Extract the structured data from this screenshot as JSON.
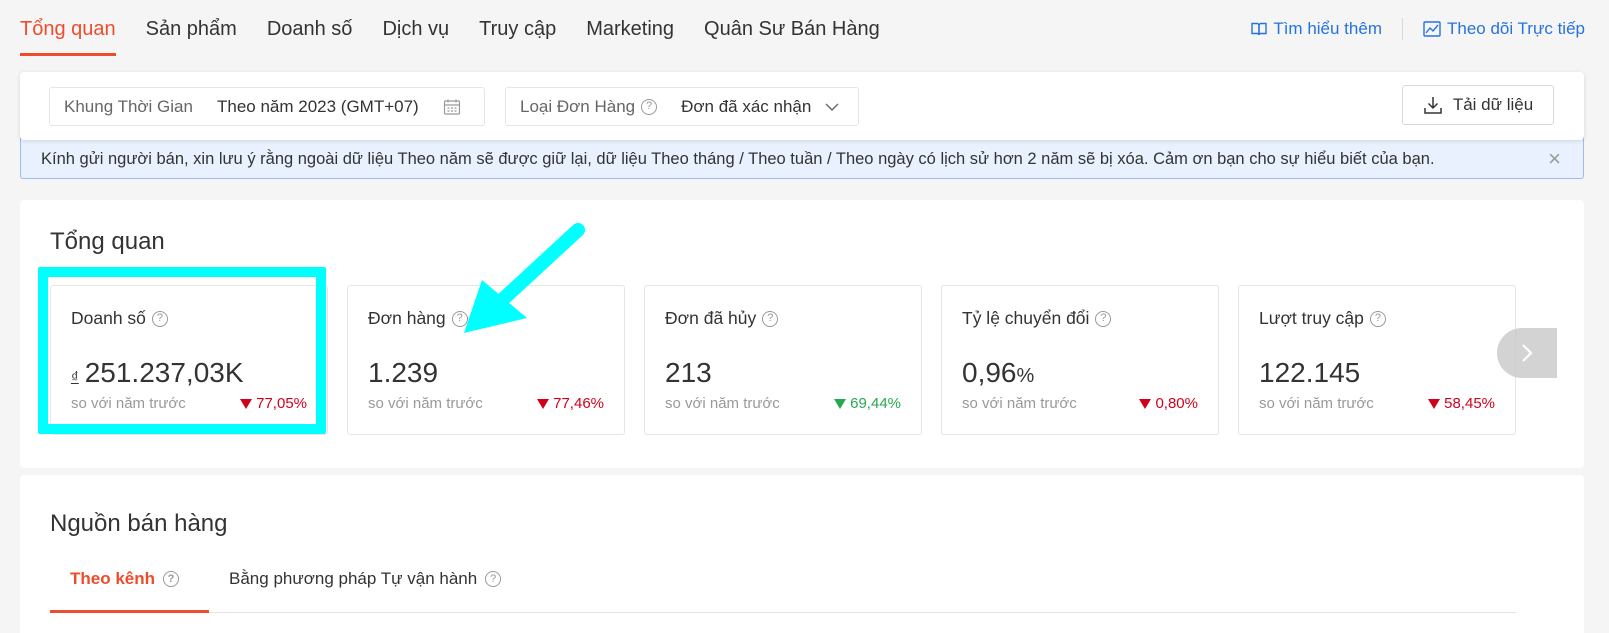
{
  "topnav": {
    "tabs": [
      {
        "label": "Tổng quan",
        "active": true
      },
      {
        "label": "Sản phẩm"
      },
      {
        "label": "Doanh số"
      },
      {
        "label": "Dịch vụ"
      },
      {
        "label": "Truy cập"
      },
      {
        "label": "Marketing"
      },
      {
        "label": "Quân Sư Bán Hàng"
      }
    ],
    "learn_more": "Tìm hiểu thêm",
    "live_tracking": "Theo dõi Trực tiếp"
  },
  "filters": {
    "time_label": "Khung Thời Gian",
    "time_value": "Theo năm  2023 (GMT+07)",
    "order_type_label": "Loại Đơn Hàng",
    "order_type_value": "Đơn đã xác nhận",
    "download_label": "Tải dữ liệu"
  },
  "notice": {
    "text": "Kính gửi người bán, xin lưu ý rằng ngoài dữ liệu Theo năm sẽ được giữ lại, dữ liệu Theo tháng / Theo tuần / Theo ngày có lịch sử hơn 2 năm sẽ bị xóa. Cảm ơn bạn cho sự hiểu biết của bạn.",
    "close": "×"
  },
  "overview": {
    "title": "Tổng quan",
    "metrics": [
      {
        "title": "Doanh số",
        "currency": "₫",
        "value": "251.237,03K",
        "unit": "",
        "compare": "so với năm trước",
        "change": "77,05%",
        "direction": "down"
      },
      {
        "title": "Đơn hàng",
        "currency": "",
        "value": "1.239",
        "unit": "",
        "compare": "so với năm trước",
        "change": "77,46%",
        "direction": "down"
      },
      {
        "title": "Đơn đã hủy",
        "currency": "",
        "value": "213",
        "unit": "",
        "compare": "so với năm trước",
        "change": "69,44%",
        "direction": "up"
      },
      {
        "title": "Tỷ lệ chuyển đổi",
        "currency": "",
        "value": "0,96",
        "unit": "%",
        "compare": "so với năm trước",
        "change": "0,80%",
        "direction": "down"
      },
      {
        "title": "Lượt truy cập",
        "currency": "",
        "value": "122.145",
        "unit": "",
        "compare": "so với năm trước",
        "change": "58,45%",
        "direction": "down"
      }
    ]
  },
  "source": {
    "title": "Nguồn bán hàng",
    "tabs": [
      {
        "label": "Theo kênh",
        "active": true
      },
      {
        "label": "Bằng phương pháp Tự vận hành"
      }
    ]
  },
  "colors": {
    "accent": "#ee4d2d",
    "link": "#2673dd",
    "down": "#d0011b",
    "up": "#26aa50",
    "annotation": "#00ffff"
  }
}
